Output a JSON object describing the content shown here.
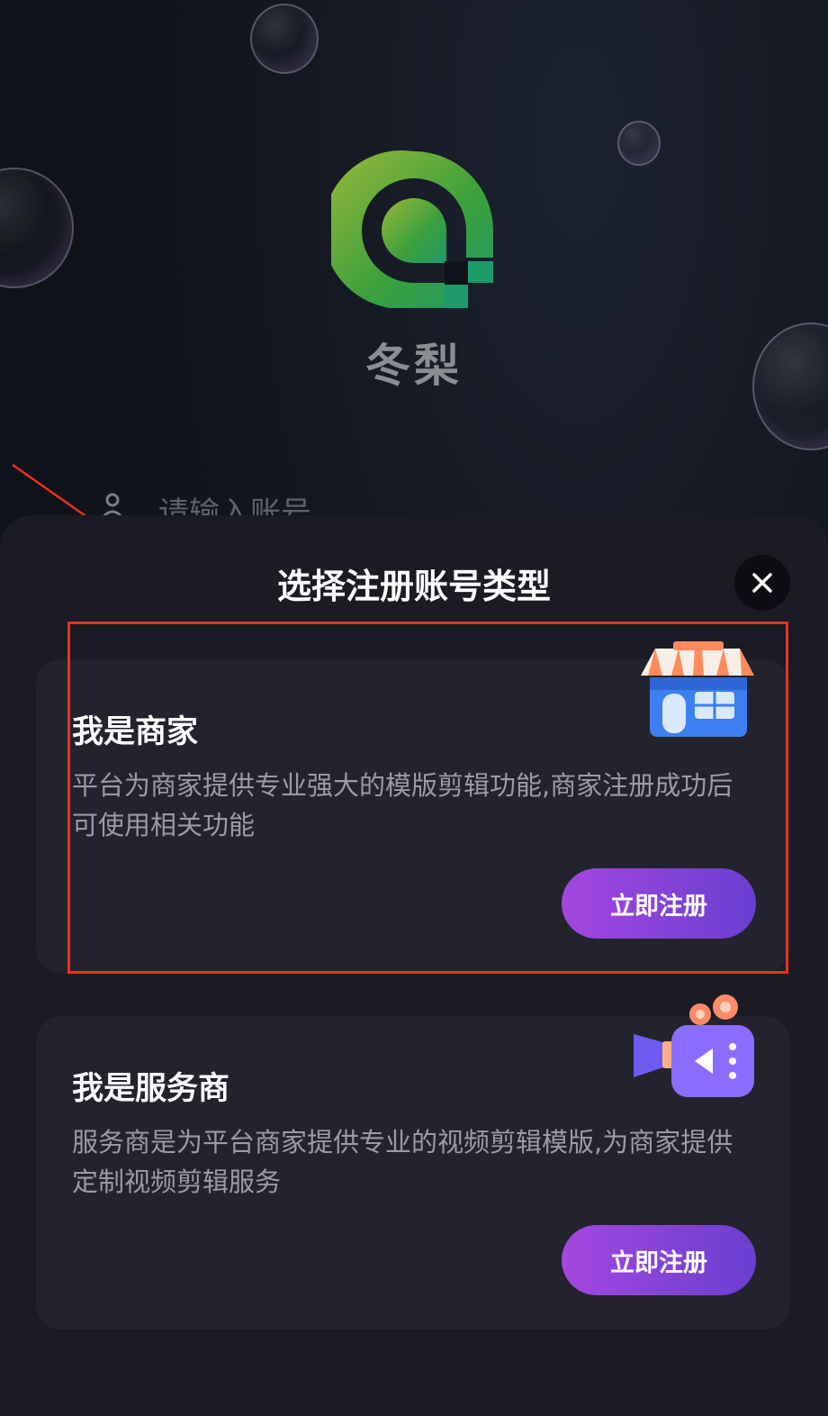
{
  "app": {
    "name": "冬梨",
    "logo_icon": "app-logo-icon",
    "brand_colors": [
      "#8ab83a",
      "#2fa34a",
      "#1e9a6e"
    ]
  },
  "login": {
    "account_placeholder": "请输入账号",
    "user_icon": "user-icon"
  },
  "sheet": {
    "title": "选择注册账号类型",
    "close_icon": "close-icon",
    "options": [
      {
        "title": "我是商家",
        "description": "平台为商家提供专业强大的模版剪辑功能,商家注册成功后可使用相关功能",
        "button_label": "立即注册",
        "illustration": "store-icon"
      },
      {
        "title": "我是服务商",
        "description": "服务商是为平台商家提供专业的视频剪辑模版,为商家提供定制视频剪辑服务",
        "button_label": "立即注册",
        "illustration": "video-camera-icon"
      }
    ]
  },
  "annotation": {
    "color": "#e8321f"
  },
  "theme": {
    "sheet_bg": "#1a1b23",
    "card_bg": "#22232c",
    "button_gradient": [
      "#a347e0",
      "#6a3fd0"
    ]
  }
}
